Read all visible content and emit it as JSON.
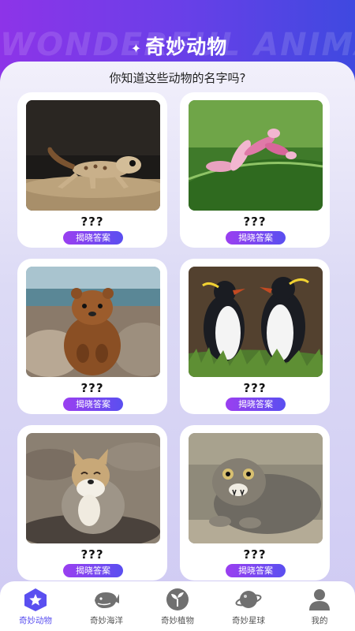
{
  "header": {
    "background_text": "WONDERFUL ANIMALS",
    "title": "奇妙动物",
    "sparkle": "✦"
  },
  "subtitle": "你知道这些动物的名字吗?",
  "cards": [
    {
      "question": "???",
      "button": "揭晓答案"
    },
    {
      "question": "???",
      "button": "揭晓答案"
    },
    {
      "question": "???",
      "button": "揭晓答案"
    },
    {
      "question": "???",
      "button": "揭晓答案"
    },
    {
      "question": "???",
      "button": "揭晓答案"
    },
    {
      "question": "???",
      "button": "揭晓答案"
    }
  ],
  "tabs": [
    {
      "label": "奇妙动物",
      "icon": "star-badge-icon",
      "active": true
    },
    {
      "label": "奇妙海洋",
      "icon": "whale-icon",
      "active": false
    },
    {
      "label": "奇妙植物",
      "icon": "sprout-icon",
      "active": false
    },
    {
      "label": "奇妙星球",
      "icon": "planet-icon",
      "active": false
    },
    {
      "label": "我的",
      "icon": "user-icon",
      "active": false
    }
  ],
  "colors": {
    "header_gradient_start": "#8d34e8",
    "header_gradient_end": "#3f49e0",
    "accent": "#5a4ff0"
  }
}
